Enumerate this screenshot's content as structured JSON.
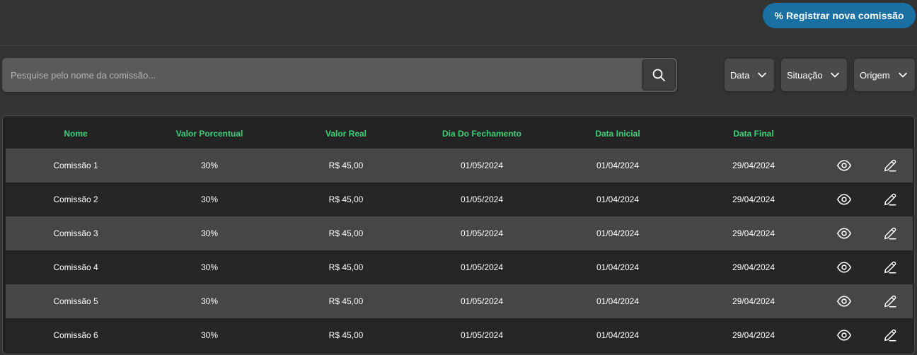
{
  "header": {
    "register_label": "Registrar nova comissão",
    "register_icon": "%"
  },
  "search": {
    "placeholder": "Pesquise pelo nome da comissão...",
    "value": ""
  },
  "filters": [
    {
      "label": "Data"
    },
    {
      "label": "Situação"
    },
    {
      "label": "Origem"
    }
  ],
  "table": {
    "columns": [
      "Nome",
      "Valor Porcentual",
      "Valor Real",
      "Dia Do Fechamento",
      "Data Inicial",
      "Data Final"
    ],
    "rows": [
      [
        "Comissão 1",
        "30%",
        "R$ 45,00",
        "01/05/2024",
        "01/04/2024",
        "29/04/2024"
      ],
      [
        "Comissão 2",
        "30%",
        "R$ 45,00",
        "01/05/2024",
        "01/04/2024",
        "29/04/2024"
      ],
      [
        "Comissão 3",
        "30%",
        "R$ 45,00",
        "01/05/2024",
        "01/04/2024",
        "29/04/2024"
      ],
      [
        "Comissão 4",
        "30%",
        "R$ 45,00",
        "01/05/2024",
        "01/04/2024",
        "29/04/2024"
      ],
      [
        "Comissão 5",
        "30%",
        "R$ 45,00",
        "01/05/2024",
        "01/04/2024",
        "29/04/2024"
      ],
      [
        "Comissão 6",
        "30%",
        "R$ 45,00",
        "01/05/2024",
        "01/04/2024",
        "29/04/2024"
      ]
    ],
    "row_actions": [
      "eye-icon",
      "pencil-icon"
    ]
  },
  "colors": {
    "accent": "#1a6fa3",
    "header_text": "#3fd07a",
    "background": "#333333"
  }
}
